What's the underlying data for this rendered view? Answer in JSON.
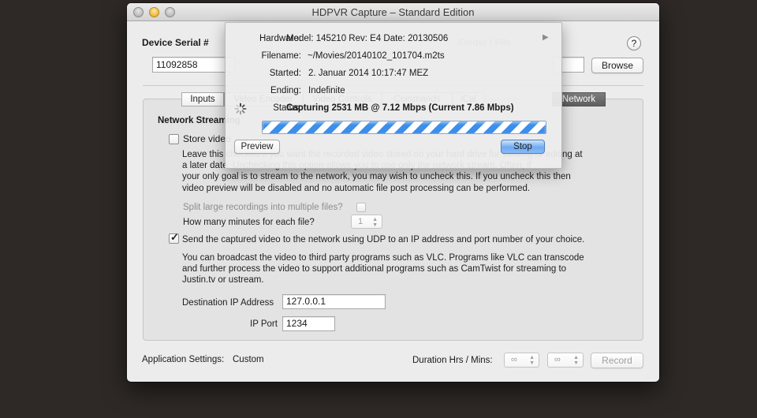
{
  "window": {
    "title": "HDPVR Capture – Standard Edition"
  },
  "device": {
    "serial_label": "Device Serial #",
    "serial_value": "11092858",
    "folder_label": "Folder / File",
    "browse_label": "Browse",
    "help_label": "?"
  },
  "tabs": [
    {
      "label": "Inputs",
      "selected": false
    },
    {
      "label": "Video Encoder",
      "selected": false
    },
    {
      "label": "Video Controls",
      "selected": false
    },
    {
      "label": "Commands",
      "selected": false
    },
    {
      "label": "iCal",
      "selected": false
    },
    {
      "label": "Network",
      "selected": true
    }
  ],
  "network": {
    "section_title": "Network Streaming",
    "store_video_label": "Store video",
    "store_video_checked": false,
    "store_desc": "Leave this checked if you want the recorded video stored on your hard drive for viewing or editing at a later date. Unchecking this option allows you to use only the network stream. Often, if your only goal is to stream to the network, you may wish to uncheck this. If you uncheck this then video preview will be disabled and no automatic file post processing can be performed.",
    "store_desc_lines": [
      "Leave this checked if you want the recorded video stored on your hard drive for viewing or editing at",
      "a later date. Unchecking this option allows you to use only the network stream. Often, if",
      "your only goal is to stream to the network, you may wish to uncheck this. If you uncheck this then",
      "video preview will be disabled and no automatic file post processing can be performed."
    ],
    "split_label": "Split large recordings into multiple files?",
    "split_checked": false,
    "minutes_label": "How many minutes for each file?",
    "minutes_value": "1",
    "udp_label": "Send the captured video to the network using UDP to an IP address and port number of your choice.",
    "udp_checked": true,
    "udp_desc_lines": [
      "You can broadcast the video to third party programs such as VLC. Programs like VLC can transcode",
      "and further process the video to support additional programs such as CamTwist for streaming to",
      "Justin.tv or ustream."
    ],
    "dest_ip_label": "Destination IP Address",
    "dest_ip_value": "127.0.0.1",
    "port_label": "IP Port",
    "port_value": "1234"
  },
  "footer": {
    "app_settings_label": "Application Settings:",
    "app_settings_value": "Custom",
    "duration_label": "Duration Hrs / Mins:",
    "hrs_value": "∞",
    "mins_value": "∞",
    "record_label": "Record"
  },
  "status_popover": {
    "hardware_label": "Hardware:",
    "hardware_value": "Model: 145210  Rev: E4 Date: 20130506",
    "filename_label": "Filename:",
    "filename_value": "~/Movies/20140102_101704.m2ts",
    "started_label": "Started:",
    "started_value": "2. Januar 2014 10:17:47 MEZ",
    "ending_label": "Ending:",
    "ending_value": "Indefinite",
    "status_label": "Status:",
    "status_value": "Capturing 2531 MB @ 7.12 Mbps (Current 7.86 Mbps)",
    "progress": "indeterminate",
    "preview_label": "Preview",
    "stop_label": "Stop"
  }
}
